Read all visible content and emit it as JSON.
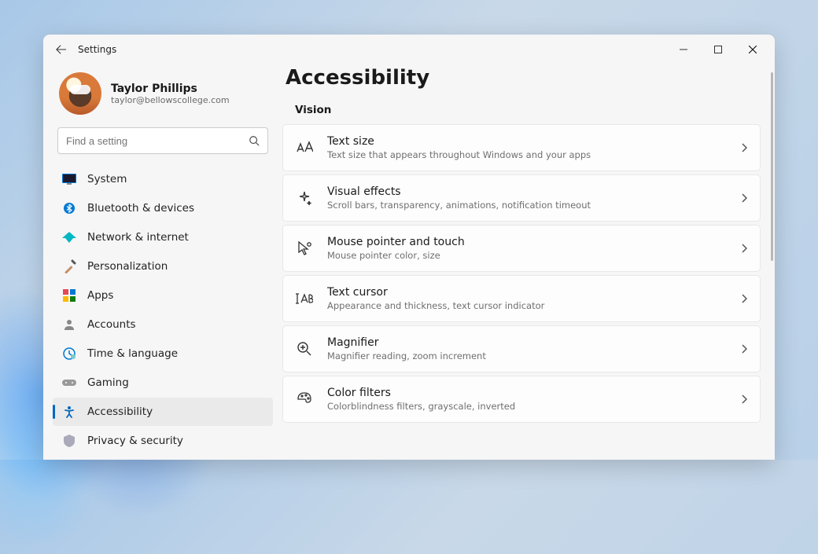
{
  "window": {
    "title": "Settings"
  },
  "profile": {
    "name": "Taylor Phillips",
    "email": "taylor@bellowscollege.com"
  },
  "search": {
    "placeholder": "Find a setting"
  },
  "nav": {
    "items": [
      {
        "label": "System",
        "icon": "system"
      },
      {
        "label": "Bluetooth & devices",
        "icon": "bluetooth"
      },
      {
        "label": "Network & internet",
        "icon": "network"
      },
      {
        "label": "Personalization",
        "icon": "personalization"
      },
      {
        "label": "Apps",
        "icon": "apps"
      },
      {
        "label": "Accounts",
        "icon": "accounts"
      },
      {
        "label": "Time & language",
        "icon": "time"
      },
      {
        "label": "Gaming",
        "icon": "gaming"
      },
      {
        "label": "Accessibility",
        "icon": "accessibility"
      },
      {
        "label": "Privacy & security",
        "icon": "privacy"
      }
    ],
    "active_index": 8
  },
  "page": {
    "title": "Accessibility",
    "section": "Vision",
    "items": [
      {
        "title": "Text size",
        "sub": "Text size that appears throughout Windows and your apps",
        "icon": "text-size"
      },
      {
        "title": "Visual effects",
        "sub": "Scroll bars, transparency, animations, notification timeout",
        "icon": "effects"
      },
      {
        "title": "Mouse pointer and touch",
        "sub": "Mouse pointer color, size",
        "icon": "mouse"
      },
      {
        "title": "Text cursor",
        "sub": "Appearance and thickness, text cursor indicator",
        "icon": "cursor"
      },
      {
        "title": "Magnifier",
        "sub": "Magnifier reading, zoom increment",
        "icon": "magnifier"
      },
      {
        "title": "Color filters",
        "sub": "Colorblindness filters, grayscale, inverted",
        "icon": "palette"
      }
    ]
  }
}
